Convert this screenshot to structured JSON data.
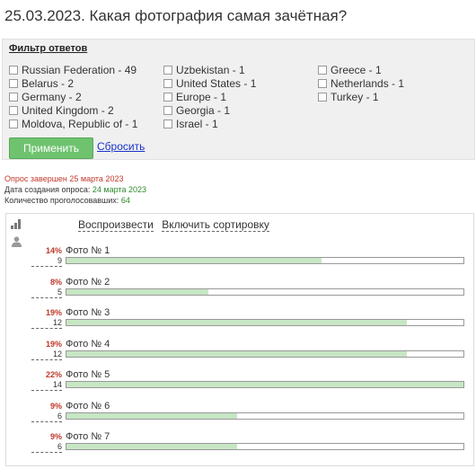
{
  "title": "25.03.2023. Какая фотография самая зачётная?",
  "filter": {
    "title": "Фильтр ответов",
    "columns": [
      [
        "Russian Federation - 49",
        "Belarus - 2",
        "Germany - 2",
        "United Kingdom - 2",
        "Moldova, Republic of - 1"
      ],
      [
        "Uzbekistan - 1",
        "United States - 1",
        "Europe - 1",
        "Georgia - 1",
        "Israel - 1"
      ],
      [
        "Greece - 1",
        "Netherlands - 1",
        "Turkey - 1"
      ]
    ],
    "apply_label": "Применить",
    "reset_label": "Сбросить"
  },
  "meta": {
    "closed": "Опрос завершен 25 марта 2023",
    "created_label": "Дата создания опроса:",
    "created_value": "24 марта 2023",
    "voters_label": "Количество проголосовавших:",
    "voters_value": "64"
  },
  "results": {
    "play_label": "Воспроизвести",
    "sort_label": "Включить сортировку",
    "items": [
      {
        "pct": "14%",
        "label": "Фото № 1",
        "count": "9",
        "share": 0.643
      },
      {
        "pct": "8%",
        "label": "Фото № 2",
        "count": "5",
        "share": 0.357
      },
      {
        "pct": "19%",
        "label": "Фото № 3",
        "count": "12",
        "share": 0.857
      },
      {
        "pct": "19%",
        "label": "Фото № 4",
        "count": "12",
        "share": 0.857
      },
      {
        "pct": "22%",
        "label": "Фото № 5",
        "count": "14",
        "share": 1.0
      },
      {
        "pct": "9%",
        "label": "Фото № 6",
        "count": "6",
        "share": 0.429
      },
      {
        "pct": "9%",
        "label": "Фото № 7",
        "count": "6",
        "share": 0.429
      }
    ]
  }
}
